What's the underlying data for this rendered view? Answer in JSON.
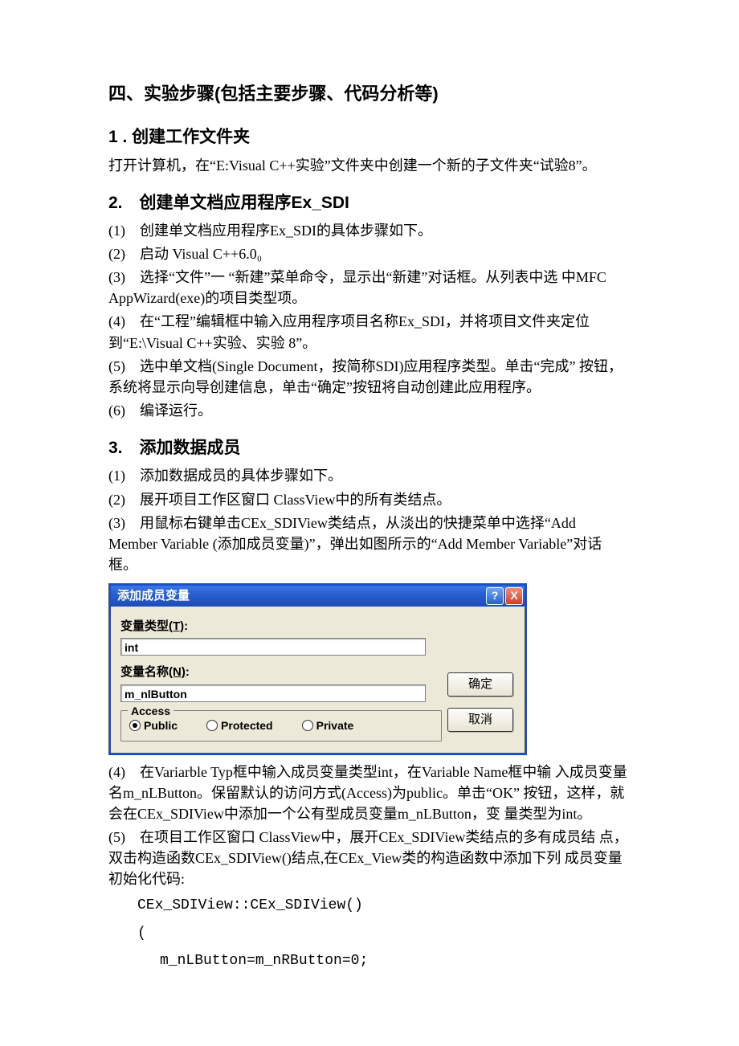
{
  "heading_main": "四、实验步骤(包括主要步骤、代码分析等)",
  "section1": {
    "title": "1 . 创建工作文件夹",
    "text": "打开计算机，在“E:Visual C++实验”文件夹中创建一个新的子文件夹“试验8”。"
  },
  "section2": {
    "title": "2.　创建单文档应用程序Ex_SDI",
    "steps": [
      "(1)　创建单文档应用程序Ex_SDI的具体步骤如下。",
      "(2)　启动 Visual C++6.0₀",
      "(3)　选择“文件”一 “新建”菜单命令，显示出“新建”对话框。从列表中选 中MFC AppWizard(exe)的项目类型项。",
      "(4)　在“工程”编辑框中输入应用程序项目名称Ex_SDI，并将项目文件夹定位 到“E:\\Visual C++实验、实验 8”。",
      "(5)　选中单文档(Single Document，按简称SDI)应用程序类型。单击“完成” 按钮，系统将显示向导创建信息，单击“确定”按钮将自动创建此应用程序。",
      "(6)　编译运行。"
    ]
  },
  "section3": {
    "title": "3.　添加数据成员",
    "steps_pre": [
      "(1)　添加数据成员的具体步骤如下。",
      "(2)　展开项目工作区窗口 ClassView中的所有类结点。",
      "(3)　用鼠标右键单击CEx_SDIView类结点，从淡出的快捷菜单中选择“Add　Member Variable (添加成员变量)”，弹出如图所示的“Add Member Variable”对话框。"
    ],
    "dialog": {
      "title": "添加成员变量",
      "label_type": "变量类型",
      "label_type_hotkey": "(T)",
      "input_type": "int",
      "label_name": "变量名称",
      "label_name_hotkey": "(N)",
      "input_name": "m_nlButton",
      "access_legend": "Access",
      "radio_public": "Public",
      "radio_protected": "Protected",
      "radio_private": "Private",
      "btn_ok": "确定",
      "btn_cancel": "取消",
      "help_icon": "?",
      "close_icon": "X"
    },
    "steps_post": [
      "(4)　在Variarble Typ框中输入成员变量类型int，在Variable Name框中输 入成员变量名m_nLButton。保留默认的访问方式(Access)为public。单击“OK” 按钮，这样，就会在CEx_SDIView中添加一个公有型成员变量m_nLButton，变 量类型为int。",
      "(5)　在项目工作区窗口 ClassView中，展开CEx_SDIView类结点的多有成员结 点，双击构造函数CEx_SDIView()结点,在CEx_View类的构造函数中添加下列 成员变量初始化代码:"
    ],
    "code": {
      "line1": "CEx_SDIView::CEx_SDIView()",
      "line2": "(",
      "line3": "m_nLButton=m_nRButton=0;"
    }
  }
}
